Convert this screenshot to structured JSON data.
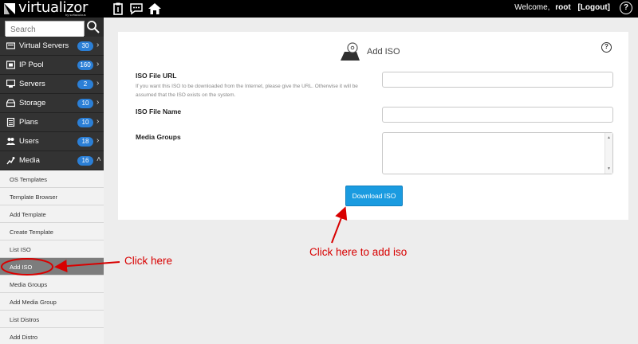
{
  "topbar": {
    "logo": "virtualizor",
    "logo_sub": "by softaculous",
    "welcome": "Welcome,",
    "user": "root",
    "logout": "[Logout]",
    "help": "?"
  },
  "sidebar": {
    "search_placeholder": "Search",
    "items": [
      {
        "label": "Virtual Servers",
        "count": "30",
        "icon": "virtual-servers-icon"
      },
      {
        "label": "IP Pool",
        "count": "160",
        "icon": "ip-icon"
      },
      {
        "label": "Servers",
        "count": "2",
        "icon": "servers-icon"
      },
      {
        "label": "Storage",
        "count": "10",
        "icon": "storage-icon"
      },
      {
        "label": "Plans",
        "count": "10",
        "icon": "plans-icon"
      },
      {
        "label": "Users",
        "count": "18",
        "icon": "users-icon"
      },
      {
        "label": "Media",
        "count": "16",
        "icon": "media-icon"
      }
    ],
    "media_subitems": [
      {
        "label": "OS Templates"
      },
      {
        "label": "Template Browser"
      },
      {
        "label": "Add Template"
      },
      {
        "label": "Create Template"
      },
      {
        "label": "List ISO"
      },
      {
        "label": "Add ISO"
      },
      {
        "label": "Media Groups"
      },
      {
        "label": "Add Media Group"
      },
      {
        "label": "List Distros"
      },
      {
        "label": "Add Distro"
      }
    ],
    "active_subitem": "Add ISO"
  },
  "main": {
    "title": "Add ISO",
    "help": "?",
    "fields": {
      "iso_url_label": "ISO File URL",
      "iso_url_help": "If you want this ISO to be downloaded from the Internet, please give the URL. Otherwise it will be assumed that the ISO exists on the system.",
      "iso_url_value": "",
      "iso_name_label": "ISO File Name",
      "iso_name_value": "",
      "media_groups_label": "Media Groups"
    },
    "submit_label": "Download ISO"
  },
  "annotations": {
    "click_here": "Click here",
    "click_add_iso": "Click here to add iso"
  },
  "colors": {
    "topbar": "#000000",
    "sidebar": "#333333",
    "badge": "#2b7fd6",
    "button": "#1a9be0",
    "annotation": "#d80000"
  }
}
